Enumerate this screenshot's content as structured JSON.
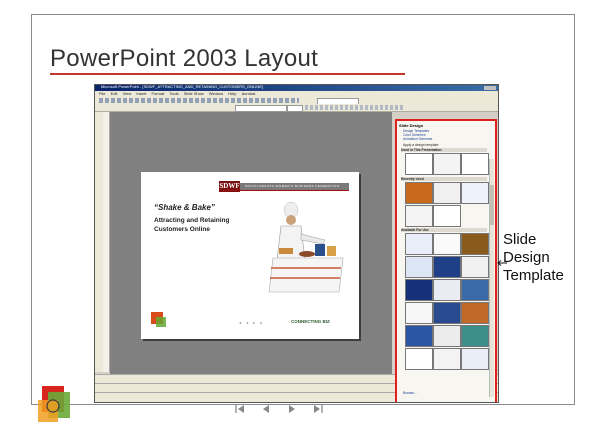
{
  "slide": {
    "title": "PowerPoint 2003 Layout"
  },
  "powerpoint_window": {
    "title_bar": "Microsoft PowerPoint - [SDWF_ATTRACTING_AND_RETAINING_CUSTOMERS_ONLINE]",
    "menu": [
      "File",
      "Edit",
      "View",
      "Insert",
      "Format",
      "Tools",
      "Slide Show",
      "Window",
      "Help",
      "Acrobat"
    ]
  },
  "preview_slide": {
    "logo": "SDWF",
    "banner": "SOUTH DAKOTA WOMEN'S BUSINESS FEDERATION",
    "headline": "“Shake & Bake”",
    "subtitle": "Attracting and Retaining Customers Online",
    "brand": "CONNECTING BIZ"
  },
  "task_pane": {
    "header": "Slide Design",
    "links": [
      "Design Templates",
      "Color Schemes",
      "Animation Schemes"
    ],
    "apply_label": "Apply a design template:",
    "sections": [
      "Used in This Presentation",
      "Recently Used",
      "Available For Use"
    ],
    "footer": "Browse..."
  },
  "annotation": {
    "lines": [
      "Slide",
      "Design",
      "Template"
    ]
  },
  "colors": {
    "highlight": "#e0201a",
    "title_rule": "#c0392b",
    "canvas": "#808080"
  },
  "navigation": {
    "first": "first-slide",
    "prev": "previous-slide",
    "next": "next-slide",
    "last": "last-slide"
  }
}
